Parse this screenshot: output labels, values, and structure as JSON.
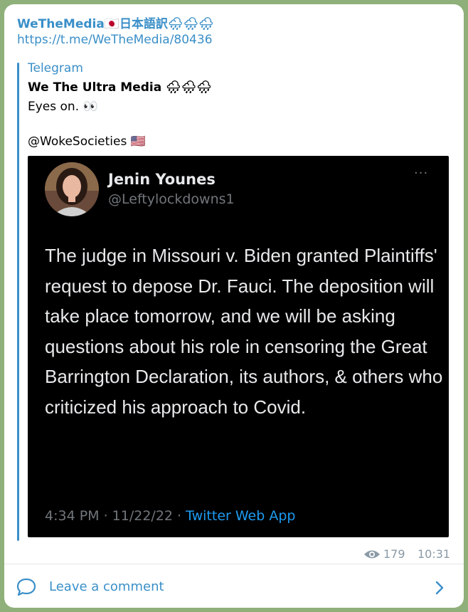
{
  "message": {
    "channel_name": "WeTheMedia🇯🇵日本語訳🌧🌧🌧",
    "link": "https://t.me/WeTheMedia/80436",
    "forward": {
      "source": "Telegram",
      "title": "We The Ultra Media 🌧🌧🌧",
      "line1": "Eyes on. 👀",
      "line2": "@WokeSocieties 🇺🇸"
    },
    "tweet": {
      "author_name": "Jenin Younes",
      "author_handle": "@Leftylockdowns1",
      "more": "···",
      "body": "The judge in Missouri v. Biden granted Plaintiffs' request to depose Dr. Fauci.  The deposition will take place tomorrow, and we will be asking questions about his role in censoring the Great Barrington Declaration, its authors, & others who criticized his approach to Covid.",
      "meta_time": "4:34 PM · 11/22/22 · ",
      "meta_app": "Twitter Web App"
    },
    "views": "179",
    "time": "10:31"
  },
  "comment": {
    "label": "Leave a comment",
    "icon": "comment-bubble-icon"
  },
  "colors": {
    "accent": "#3a8fc8",
    "background": "#8fb07a",
    "tweet_bg": "#000000",
    "twitter_blue": "#1d9bf0"
  }
}
